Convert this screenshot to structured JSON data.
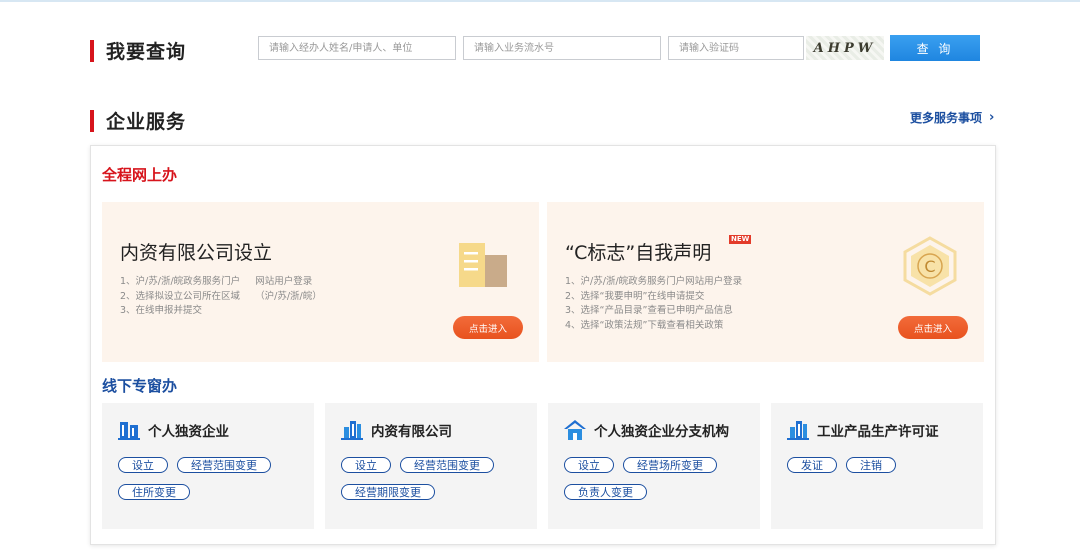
{
  "query": {
    "title": "我要查询",
    "name_placeholder": "请输入经办人姓名/申请人、单位",
    "serial_placeholder": "请输入业务流水号",
    "captcha_placeholder": "请输入验证码",
    "captcha_text": "AHPW",
    "button": "查 询"
  },
  "services": {
    "title": "企业服务",
    "more_link": "更多服务事项"
  },
  "online": {
    "title": "全程网上办",
    "cards": [
      {
        "title": "内资有限公司设立",
        "steps": [
          "1、沪/苏/浙/皖政务服务门户     网站用户登录",
          "2、选择拟设立公司所在区域     （沪/苏/浙/皖）",
          "3、在线申报并提交"
        ],
        "button": "点击进入",
        "icon": "document-folder-icon"
      },
      {
        "title": "“C标志”自我声明",
        "badge": "NEW",
        "steps": [
          "1、沪/苏/浙/皖政务服务门户网站用户登录",
          "2、选择“我要申明”在线申请提交",
          "3、选择“产品目录”查看已申明产品信息",
          "4、选择“政策法规”下载查看相关政策"
        ],
        "button": "点击进入",
        "icon": "c-mark-hexagon-icon"
      }
    ]
  },
  "offline": {
    "title": "线下专窗办",
    "cards": [
      {
        "name": "个人独资企业",
        "icon": "building-icon",
        "tags": [
          "设立",
          "经营范围变更",
          "住所变更"
        ]
      },
      {
        "name": "内资有限公司",
        "icon": "building-icon",
        "tags": [
          "设立",
          "经营范围变更",
          "经营期限变更"
        ]
      },
      {
        "name": "个人独资企业分支机构",
        "icon": "house-icon",
        "tags": [
          "设立",
          "经营场所变更",
          "负责人变更"
        ]
      },
      {
        "name": "工业产品生产许可证",
        "icon": "building-icon",
        "tags": [
          "发证",
          "注销"
        ]
      }
    ]
  },
  "colors": {
    "accent_red": "#d7141c",
    "link_blue": "#1c4fa0",
    "button_blue": "#2690e6",
    "orange": "#e8521e",
    "card_bg": "#fdf4ec"
  }
}
